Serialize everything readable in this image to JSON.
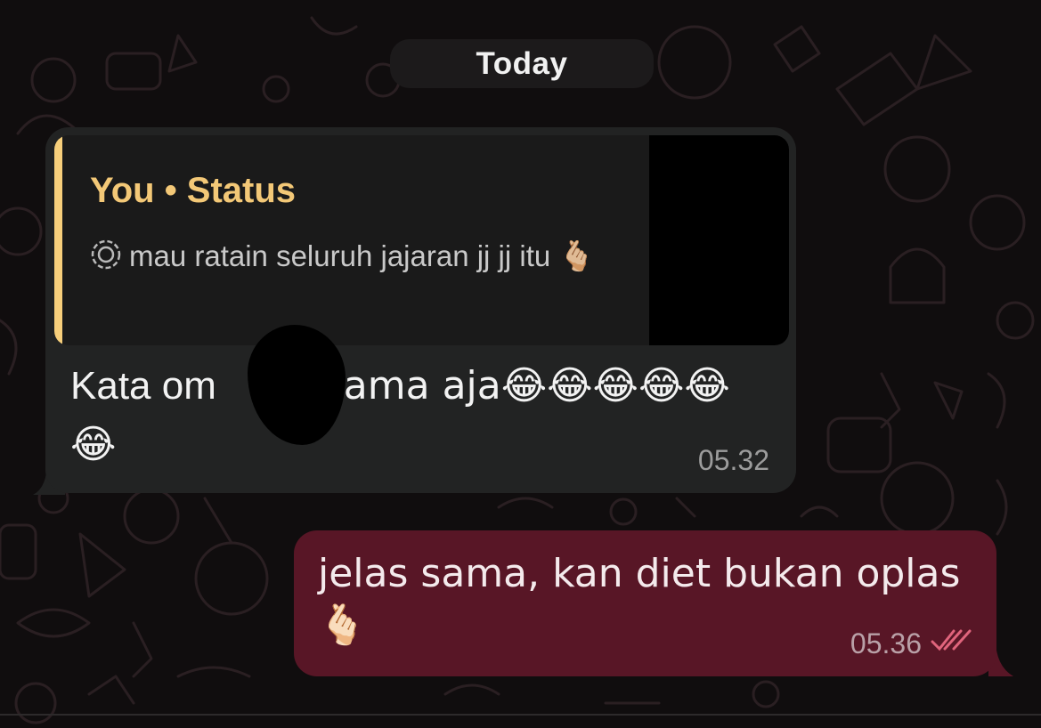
{
  "date_separator": "Today",
  "incoming": {
    "quote": {
      "title": "You • Status",
      "icon": "status-ring-icon",
      "text": "mau ratain seluruh jajaran jj jj itu 🫰🏼"
    },
    "message_before": "Kata om",
    "message_after": "sama aja😂😂😂😂😂😂",
    "time": "05.32"
  },
  "outgoing": {
    "message": "jelas sama, kan diet bukan oplas 🫰🏻",
    "time": "05.36",
    "receipt_icon": "double-check-icon"
  },
  "colors": {
    "incoming_bubble": "#222323",
    "outgoing_bubble": "#581626",
    "quote_accent": "#f7cf7b",
    "read_receipt": "#e0647c"
  }
}
